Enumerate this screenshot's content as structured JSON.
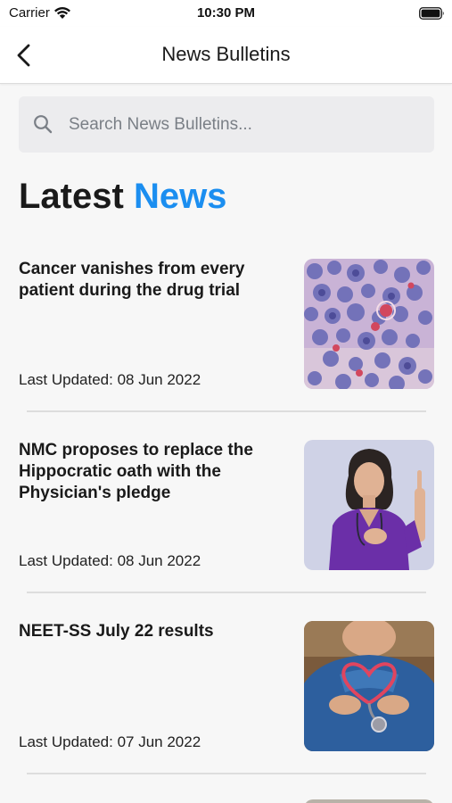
{
  "status_bar": {
    "carrier": "Carrier",
    "time": "10:30 PM",
    "icons": [
      "wifi-icon",
      "battery-icon"
    ]
  },
  "nav": {
    "title": "News Bulletins",
    "back_icon": "chevron-left-icon"
  },
  "search": {
    "placeholder": "Search News Bulletins...",
    "value": "",
    "icon": "search-icon"
  },
  "section": {
    "heading_plain": "Latest",
    "heading_accent": "News",
    "accent_color": "#1b8ef0"
  },
  "news": [
    {
      "title": "Cancer vanishes from every patient during the drug trial",
      "date": "Last Updated: 08 Jun 2022",
      "image": "cancer-cells-micrograph"
    },
    {
      "title": "NMC proposes to replace the Hippocratic oath with the Physician's pledge",
      "date": "Last Updated: 08 Jun 2022",
      "image": "doctor-taking-pledge"
    },
    {
      "title": "NEET-SS July 22 results",
      "date": "Last Updated: 07 Jun 2022",
      "image": "stethoscope-heart-hands"
    }
  ]
}
